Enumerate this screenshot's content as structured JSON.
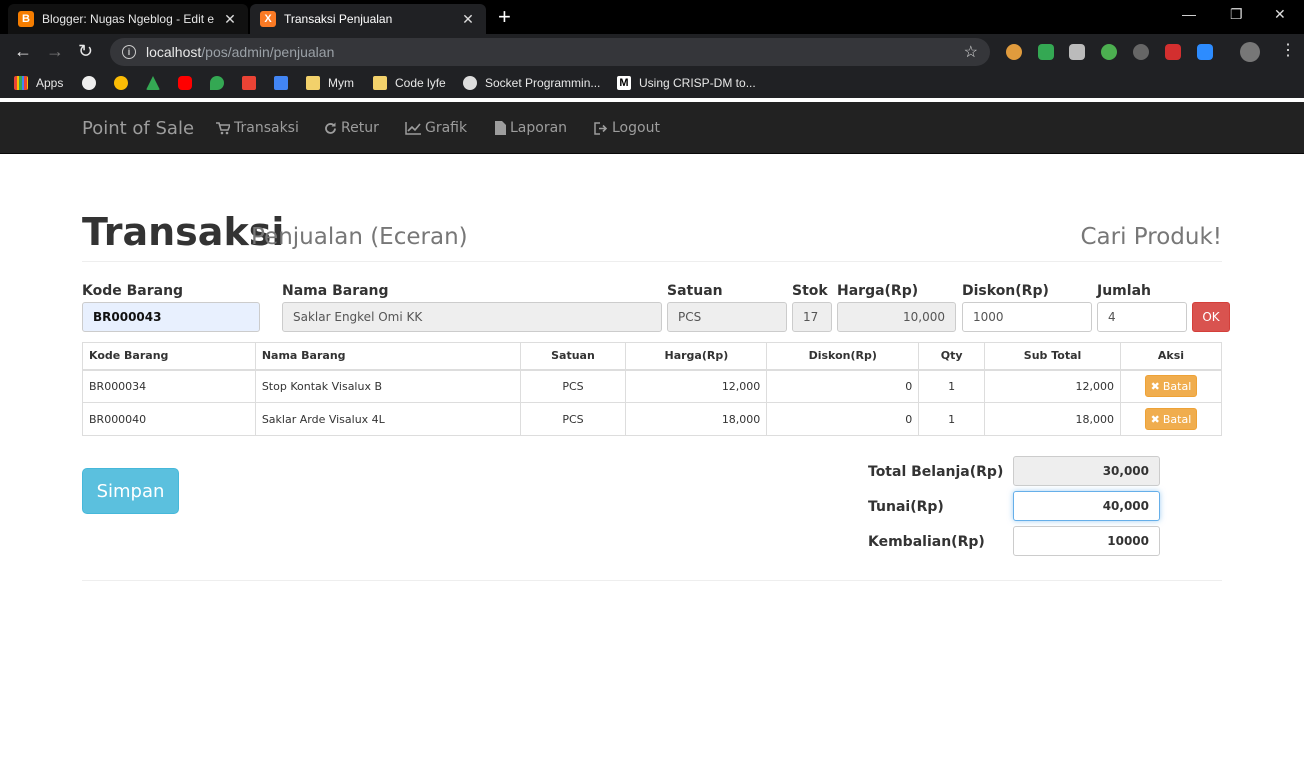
{
  "browser": {
    "tabs": [
      {
        "title": "Blogger: Nugas Ngeblog - Edit e"
      },
      {
        "title": "Transaksi Penjualan"
      }
    ],
    "url_host": "localhost",
    "url_path": "/pos/admin/penjualan",
    "bookmarks": [
      {
        "label": "Apps"
      },
      {
        "label": "Mym"
      },
      {
        "label": "Code lyfe"
      },
      {
        "label": "Socket Programmin..."
      },
      {
        "label": "Using CRISP-DM to..."
      }
    ]
  },
  "nav": {
    "brand": "Point of Sale",
    "links": [
      {
        "label": "Transaksi",
        "icon": "cart-icon"
      },
      {
        "label": "Retur",
        "icon": "refresh-icon"
      },
      {
        "label": "Grafik",
        "icon": "line-chart-icon"
      },
      {
        "label": "Laporan",
        "icon": "file-icon"
      },
      {
        "label": "Logout",
        "icon": "logout-icon"
      }
    ]
  },
  "page": {
    "title": "Transaksi",
    "subtitle": "Penjualan (Eceran)",
    "search_title": "Cari Produk!"
  },
  "form": {
    "kode_label": "Kode Barang",
    "kode_value": "BR000043",
    "nama_label": "Nama Barang",
    "nama_value": "Saklar Engkel Omi KK",
    "satuan_label": "Satuan",
    "satuan_value": "PCS",
    "stok_label": "Stok",
    "stok_value": "17",
    "harga_label": "Harga(Rp)",
    "harga_value": "10,000",
    "diskon_label": "Diskon(Rp)",
    "diskon_value": "1000",
    "jumlah_label": "Jumlah",
    "jumlah_value": "4",
    "ok_label": "OK"
  },
  "table": {
    "headers": [
      "Kode Barang",
      "Nama Barang",
      "Satuan",
      "Harga(Rp)",
      "Diskon(Rp)",
      "Qty",
      "Sub Total",
      "Aksi"
    ],
    "rows": [
      {
        "kode": "BR000034",
        "nama": "Stop Kontak Visalux B",
        "satuan": "PCS",
        "harga": "12,000",
        "diskon": "0",
        "qty": "1",
        "subtotal": "12,000",
        "aksi": "Batal"
      },
      {
        "kode": "BR000040",
        "nama": "Saklar Arde Visalux 4L",
        "satuan": "PCS",
        "harga": "18,000",
        "diskon": "0",
        "qty": "1",
        "subtotal": "18,000",
        "aksi": "Batal"
      }
    ]
  },
  "summary": {
    "simpan_label": "Simpan",
    "total_label": "Total Belanja(Rp)",
    "total_value": "30,000",
    "tunai_label": "Tunai(Rp)",
    "tunai_value": "40,000",
    "kembalian_label": "Kembalian(Rp)",
    "kembalian_value": "10000"
  },
  "colors": {
    "navbar_bg": "#222222",
    "ok_button": "#d9534f",
    "batal_button": "#f0ad4e",
    "simpan_button": "#5bc0de"
  }
}
